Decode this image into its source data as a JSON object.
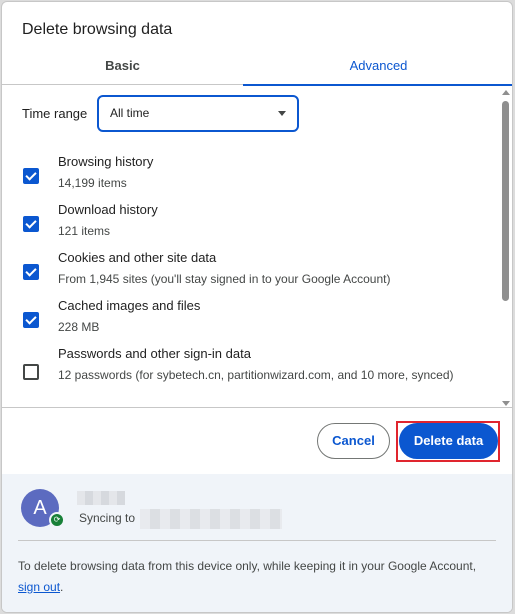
{
  "dialog": {
    "title": "Delete browsing data"
  },
  "tabs": [
    {
      "label": "Basic",
      "selected": false
    },
    {
      "label": "Advanced",
      "selected": true
    }
  ],
  "time_range": {
    "label": "Time range",
    "value": "All time"
  },
  "items": [
    {
      "title": "Browsing history",
      "description": "14,199 items",
      "checked": true
    },
    {
      "title": "Download history",
      "description": "121 items",
      "checked": true
    },
    {
      "title": "Cookies and other site data",
      "description": "From 1,945 sites (you'll stay signed in to your Google Account)",
      "checked": true
    },
    {
      "title": "Cached images and files",
      "description": "228 MB",
      "checked": true
    },
    {
      "title": "Passwords and other sign-in data",
      "description": "12 passwords (for sybetech.cn, partitionwizard.com, and 10 more, synced)",
      "checked": false
    }
  ],
  "actions": {
    "cancel_label": "Cancel",
    "delete_label": "Delete data"
  },
  "account": {
    "avatar_letter": "A",
    "syncing_label": "Syncing to"
  },
  "footer": {
    "text_before": "To delete browsing data from this device only, while keeping it in your Google Account, ",
    "link": "sign out",
    "text_after": "."
  },
  "colors": {
    "accent": "#0b57d0",
    "highlight": "#e0252e",
    "account_bg": "#f0f4f9"
  }
}
